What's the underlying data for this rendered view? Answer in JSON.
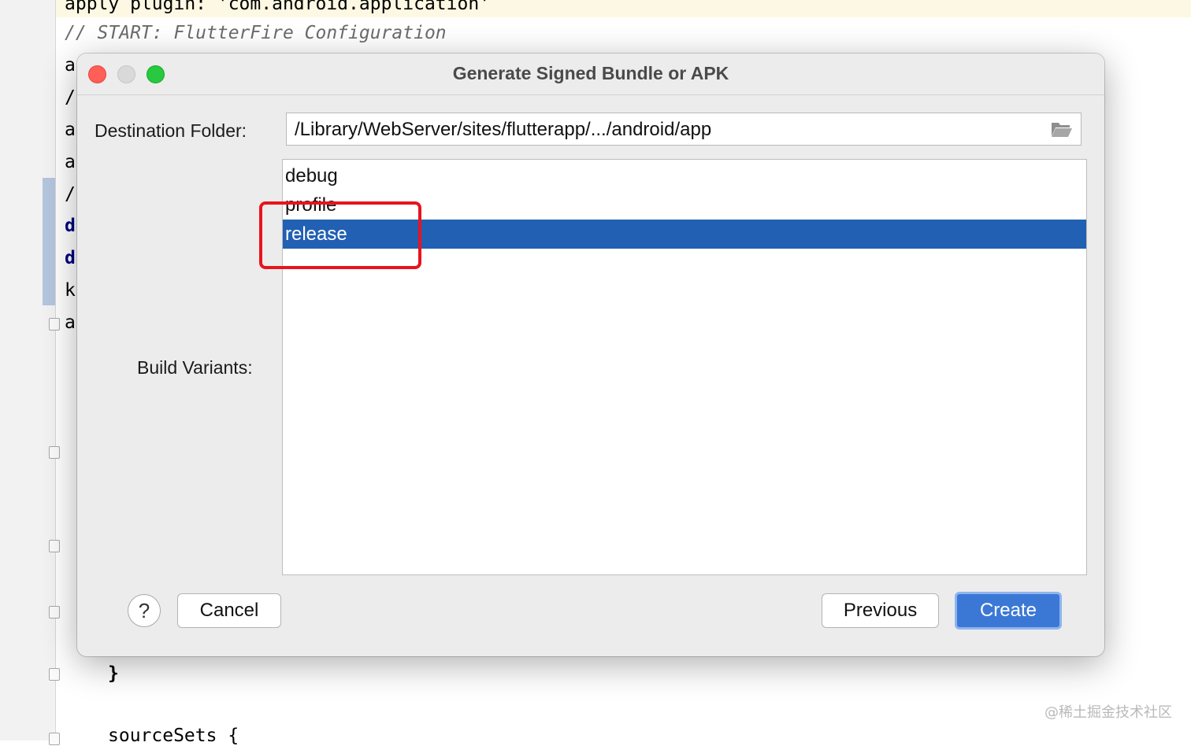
{
  "editor": {
    "line_apply": "apply plugin: 'com.android.application'",
    "line_comment": "// START: FlutterFire Configuration",
    "peek_lines": [
      "a",
      "/",
      "a",
      "a",
      "/",
      "d",
      "d",
      "k",
      "a"
    ],
    "closing_brace": "}",
    "source_sets": "sourceSets {",
    "watermark": "@稀土掘金技术社区"
  },
  "dialog": {
    "title": "Generate Signed Bundle or APK",
    "destination_label": "Destination Folder:",
    "destination_value": "/Library/WebServer/sites/flutterapp/.../android/app",
    "build_variants_label": "Build Variants:",
    "variants": [
      {
        "label": "debug",
        "selected": false
      },
      {
        "label": "profile",
        "selected": false
      },
      {
        "label": "release",
        "selected": true
      }
    ],
    "help_label": "?",
    "cancel_label": "Cancel",
    "previous_label": "Previous",
    "create_label": "Create"
  },
  "colors": {
    "selection": "#2160b3",
    "primary_button": "#3b78d6",
    "annotation": "#e8141e"
  },
  "icons": {
    "folder": "folder-open-icon",
    "help": "question-icon"
  }
}
